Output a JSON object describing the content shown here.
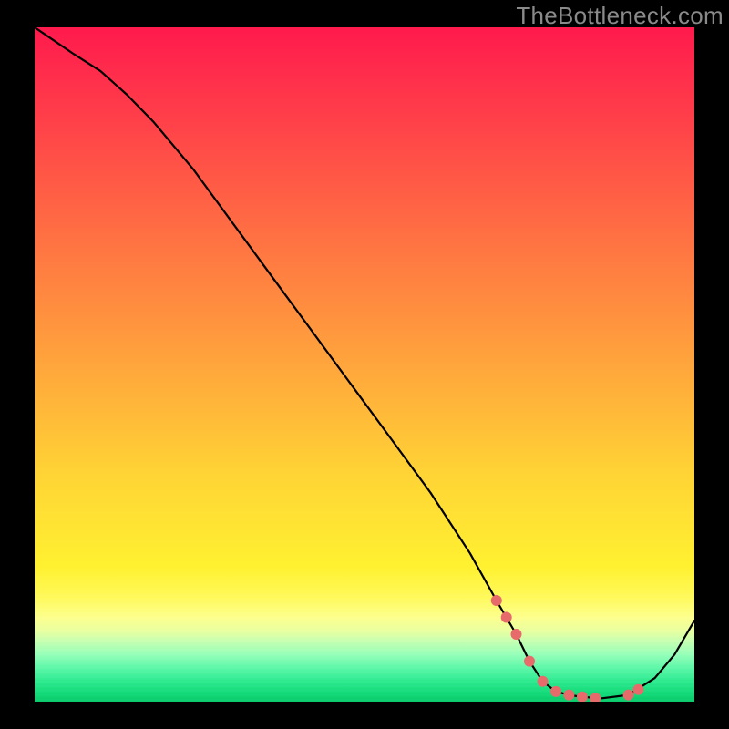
{
  "watermark": "TheBottleneck.com",
  "chart_data": {
    "type": "line",
    "title": "",
    "xlabel": "",
    "ylabel": "",
    "xlim": [
      0,
      100
    ],
    "ylim": [
      0,
      100
    ],
    "grid": false,
    "series": [
      {
        "name": "curve",
        "color": "#000000",
        "x": [
          0,
          3,
          6,
          10,
          14,
          18,
          24,
          30,
          36,
          42,
          48,
          54,
          60,
          66,
          70,
          73,
          75,
          77,
          79,
          81,
          83,
          86,
          90,
          94,
          97,
          100
        ],
        "values": [
          100,
          98,
          96,
          93.5,
          90,
          86,
          79,
          71,
          63,
          55,
          47,
          39,
          31,
          22,
          15,
          10,
          6,
          3,
          1.5,
          1,
          0.7,
          0.5,
          1.0,
          3.5,
          7.0,
          12
        ]
      }
    ],
    "markers": {
      "name": "markers",
      "color": "#e86b6b",
      "x": [
        70,
        71.5,
        73,
        75,
        77,
        79,
        81,
        83,
        85,
        90,
        91.5
      ],
      "values": [
        15,
        12.5,
        10,
        6,
        3,
        1.5,
        1,
        0.7,
        0.5,
        1.0,
        1.8
      ]
    },
    "bathtub_label": ""
  }
}
